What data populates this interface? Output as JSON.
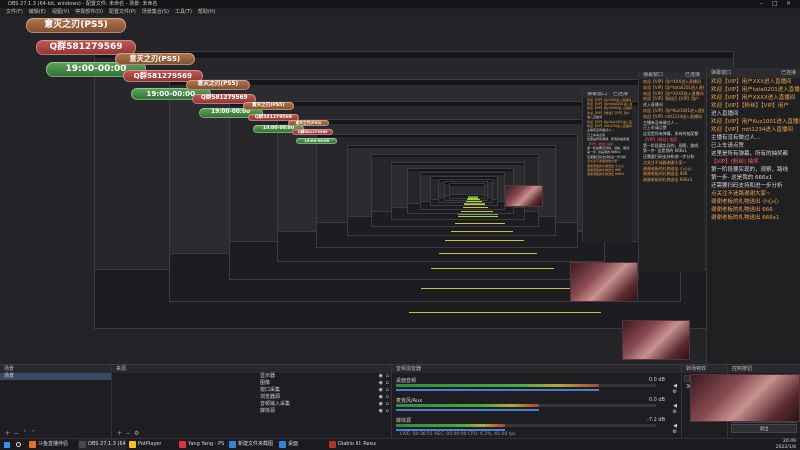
{
  "window": {
    "title": "OBS 27.1.3 (64-bit, windows) - 配置文件: 未命名 - 场景: 未命名"
  },
  "menu": [
    "文件(F)",
    "编辑(E)",
    "视图(V)",
    "停靠部件(D)",
    "配置文件(P)",
    "场景集合(S)",
    "工具(T)",
    "帮助(H)"
  ],
  "overlay": {
    "game": "意灭之刃(PS5)",
    "qq": "Q群581279569",
    "time": "19:00-00:00"
  },
  "chat": {
    "header": "弹幕窗口",
    "header_right": "已连接",
    "lines": [
      {
        "t": "欢迎【VIP】用户XXX进入直播间",
        "c": "o"
      },
      {
        "t": "欢迎【VIP】用户tata0201进入直播间",
        "c": "o"
      },
      {
        "t": "欢迎【VIP】用户XXXX进入直播间",
        "c": "o"
      },
      {
        "t": "欢迎【VIP】【粉丝】【VIP】用户",
        "c": "o"
      },
      {
        "t": "进入直播间",
        "c": ""
      },
      {
        "t": "欢迎【VIP】用户Kuz1001进入直播间",
        "c": "o"
      },
      {
        "t": "欢迎【VIP】mtt1234进入直播间",
        "c": "o"
      },
      {
        "t": "主播有没有做过人...",
        "c": ""
      },
      {
        "t": "已上车请点赞",
        "c": ""
      },
      {
        "t": "这里是所有弹幕，所有的抽奖都",
        "c": ""
      },
      {
        "t": "【VIP】(粉丝) 抽奖",
        "c": "r"
      },
      {
        "t": "第一阶段要实现的，观察，路线",
        "c": ""
      },
      {
        "t": "第一步- 这是我的 666x1",
        "c": ""
      },
      {
        "t": "还需要扫码支持和进一步分析",
        "c": ""
      },
      {
        "t": "点关注不迷路谢谢大家~",
        "c": "o"
      },
      {
        "t": "谢谢老板的礼物送出 小心心",
        "c": "o"
      },
      {
        "t": "谢谢老板的礼物送出 666",
        "c": "o"
      },
      {
        "t": "谢谢老板的礼物送出 666x1",
        "c": "o"
      }
    ]
  },
  "dock": {
    "scenes": {
      "title": "场景",
      "items": [
        "场景"
      ]
    },
    "sources": {
      "title": "来源",
      "items": [
        "显示器",
        "图像",
        "窗口采集",
        "浏览器源",
        "音频输入采集",
        "媒体源"
      ]
    },
    "mixer": {
      "title": "音频混音器",
      "channels": [
        {
          "name": "桌面音频",
          "db": "0.0 dB",
          "level": 0.78
        },
        {
          "name": "麦克风/Aux",
          "db": "0.0 dB",
          "level": 0.55
        },
        {
          "name": "媒体源",
          "db": "-7.2 dB",
          "level": 0.42
        }
      ]
    },
    "transitions": {
      "title": "转场特效",
      "value": "淡出",
      "duration": "300 ms"
    },
    "controls": {
      "title": "控制按钮",
      "buttons": [
        "开始推流",
        "开始录制",
        "启动虚拟摄像机",
        "工作室模式",
        "设置",
        "退出"
      ]
    },
    "status": "LIVE: 00:36:51  REC: 00:00:00  CPU: 6.2%, 60.00 fps"
  },
  "taskbar": {
    "items": [
      {
        "label": "斗鱼直播伴侣",
        "color": "#e3731f"
      },
      {
        "label": "OBS 27.1.3 (64-bit)",
        "color": "#454a57"
      },
      {
        "label": "PotPlayer",
        "color": "#f1c22e"
      },
      {
        "label": "Yang Yang - PS",
        "color": "#d6374a"
      },
      {
        "label": "新建文件夹截图",
        "color": "#2d88d8"
      },
      {
        "label": "桌面",
        "color": "#2d88d8"
      },
      {
        "label": "Diablo III: Resurrection",
        "color": "#b6342f"
      }
    ],
    "time": "20:49",
    "date": "2022/1/8"
  },
  "colors": {
    "accent": "#4d7fd0",
    "danmaku_orange": "#f0a24a",
    "danmaku_red": "#ff5c55"
  }
}
